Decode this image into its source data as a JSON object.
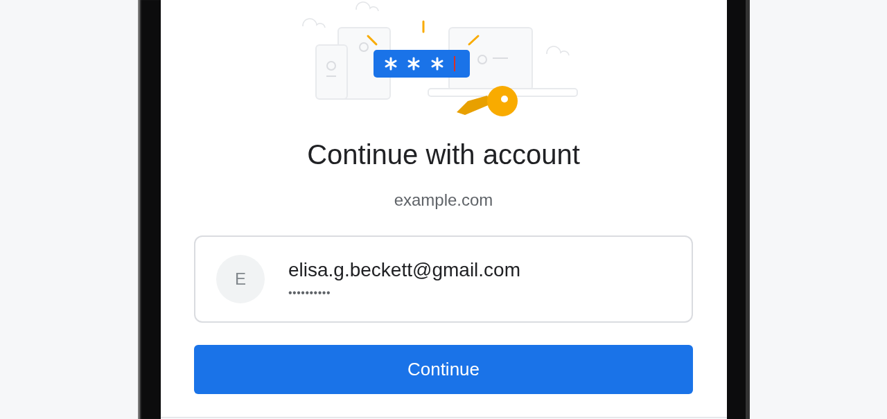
{
  "dialog": {
    "title": "Continue with account",
    "domain": "example.com"
  },
  "account": {
    "initial": "E",
    "email": "elisa.g.beckett@gmail.com",
    "password": "••••••••••"
  },
  "continue_button": {
    "label": "Continue"
  }
}
